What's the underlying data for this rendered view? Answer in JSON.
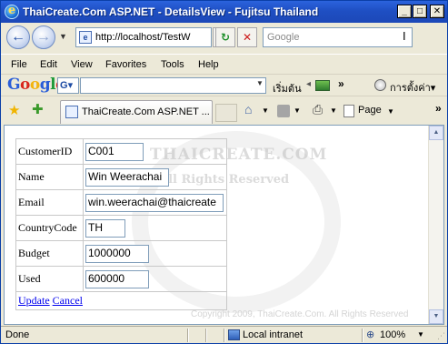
{
  "window": {
    "title": "ThaiCreate.Com ASP.NET - DetailsView - Fujitsu Thailand",
    "min_glyph": "_",
    "max_glyph": "□",
    "close_glyph": "✕"
  },
  "nav": {
    "back_glyph": "←",
    "forward_glyph": "→",
    "address": "http://localhost/TestW",
    "refresh_glyph": "↻",
    "stop_glyph": "✕",
    "search_placeholder": "Google"
  },
  "menu": [
    "File",
    "Edit",
    "View",
    "Favorites",
    "Tools",
    "Help"
  ],
  "google_toolbar": {
    "logo": "Google",
    "g_button": "G",
    "start_label": "เริ่มต้น",
    "more": "»",
    "settings_label": "การตั้งค่า"
  },
  "tabbar": {
    "tab_title": "ThaiCreate.Com ASP.NET ...",
    "page_label": "Page",
    "more": "»"
  },
  "watermark": {
    "line1": "THAICREATE.COM",
    "line2": "All Rights Reserved",
    "copyright": "Copyright 2009, ThaiCreate.Com. All Rights Reserved"
  },
  "form": {
    "rows": [
      {
        "label": "CustomerID",
        "value": "C001"
      },
      {
        "label": "Name",
        "value": "Win Weerachai"
      },
      {
        "label": "Email",
        "value": "win.weerachai@thaicreate"
      },
      {
        "label": "CountryCode",
        "value": "TH"
      },
      {
        "label": "Budget",
        "value": "1000000"
      },
      {
        "label": "Used",
        "value": "600000"
      }
    ],
    "update_label": "Update",
    "cancel_label": "Cancel"
  },
  "status": {
    "text": "Done",
    "zone": "Local intranet",
    "zoom": "100%"
  },
  "colors": {
    "titlebar": "#1f4fc3",
    "link": "#0000ee",
    "chrome": "#ece9d8"
  }
}
